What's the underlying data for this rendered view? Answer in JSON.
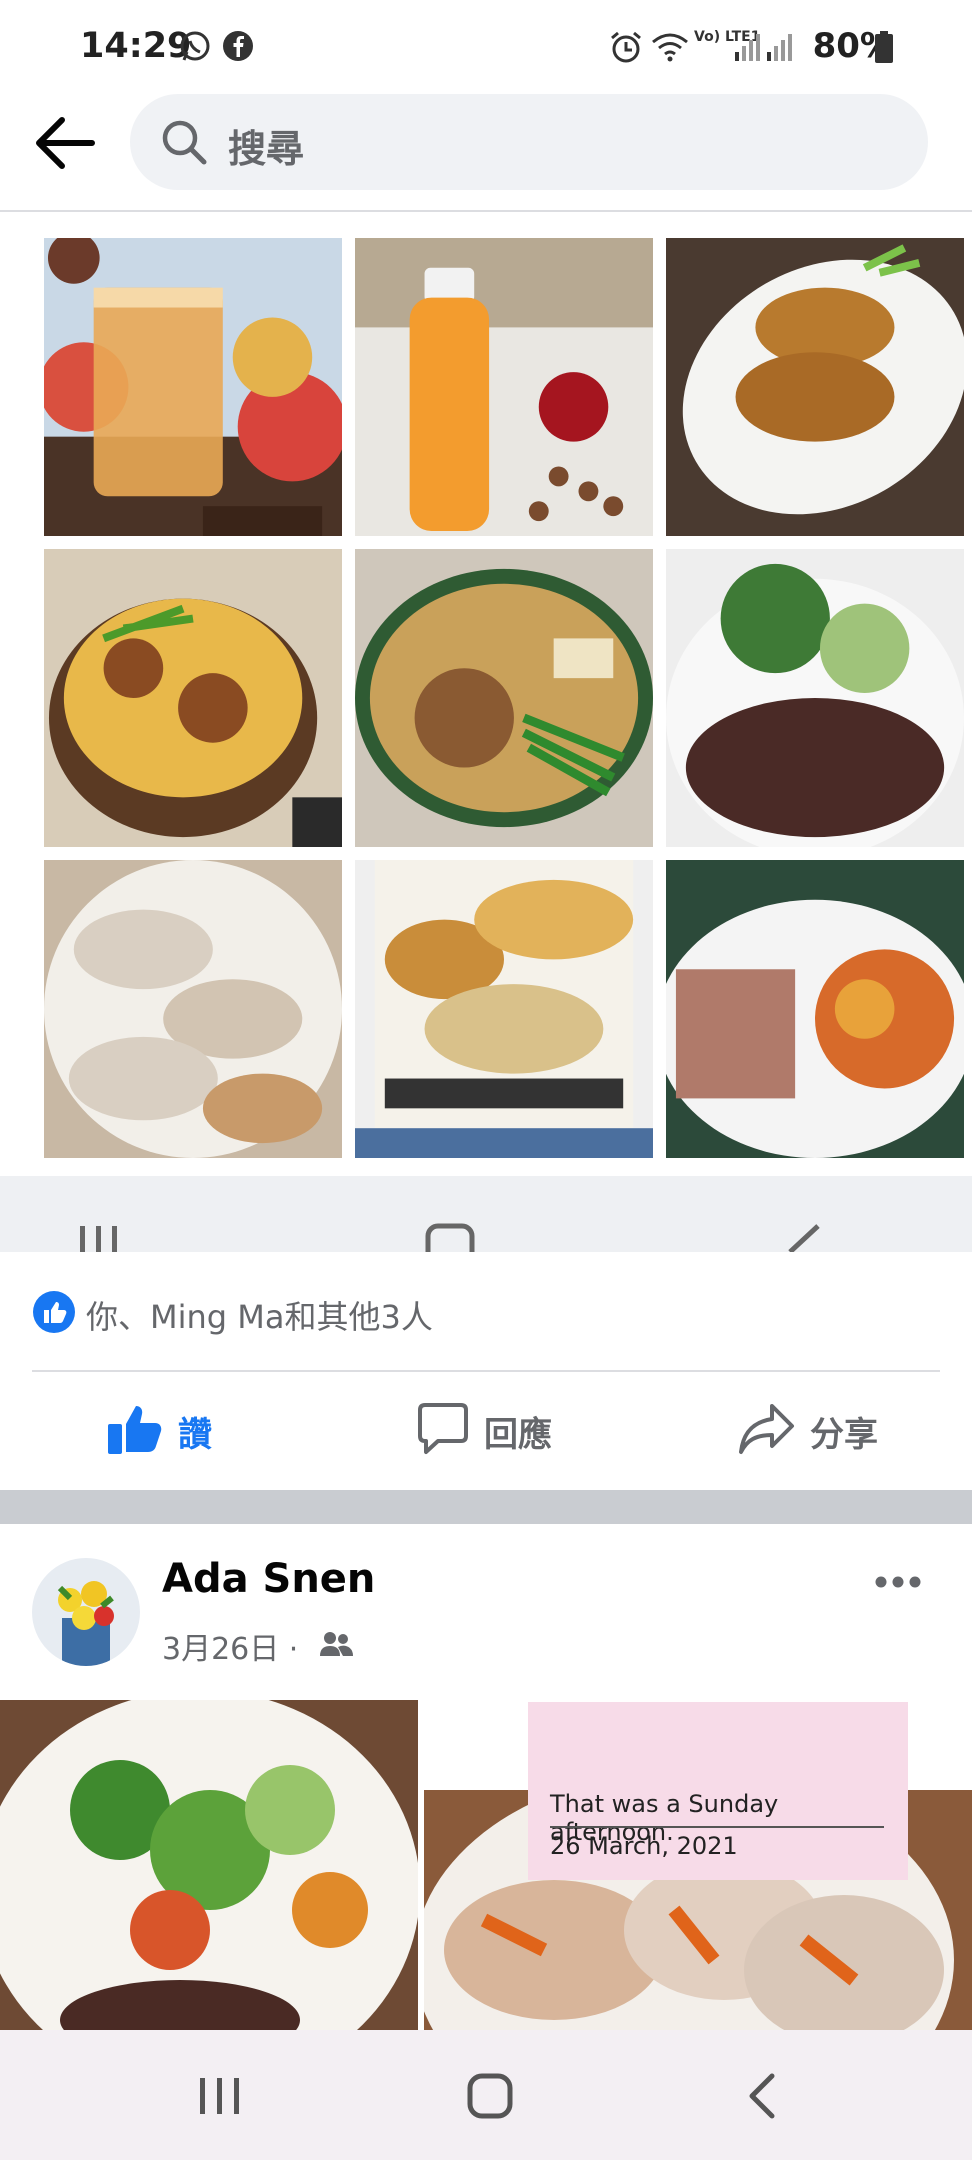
{
  "status_bar": {
    "time": "14:29",
    "battery": "80%",
    "network_label": "Vo) LTE1",
    "left_icons": [
      "whatsapp-icon",
      "facebook-icon"
    ],
    "right_icons": [
      "alarm-icon",
      "wifi-icon",
      "signal-icon",
      "signal-icon",
      "battery-icon"
    ]
  },
  "header": {
    "search_placeholder": "搜尋",
    "back_icon": "back-arrow-icon",
    "search_icon": "search-icon"
  },
  "photo_grid": [
    {
      "name": "apple-tea"
    },
    {
      "name": "juice-bottle"
    },
    {
      "name": "fried-chicken-wings"
    },
    {
      "name": "chicken-rice-bowl"
    },
    {
      "name": "minced-pork-noodle"
    },
    {
      "name": "cucumber-salad"
    },
    {
      "name": "dumplings"
    },
    {
      "name": "meal-printout"
    },
    {
      "name": "pork-and-tofu"
    }
  ],
  "post1": {
    "reactions_text": "你、Ming Ma和其他3人",
    "actions": {
      "like_label": "讚",
      "comment_label": "回應",
      "share_label": "分享"
    }
  },
  "post2": {
    "author": "Ada Snen",
    "date": "3月26日 ·",
    "audience_icon": "friends-icon",
    "more_icon": "more-icon",
    "note_line1": "That was a Sunday afternoon.",
    "note_line2": "26 March, 2021"
  },
  "colors": {
    "accent": "#1877f2",
    "secondary_text": "#65676b",
    "divider": "#dcdde1",
    "search_bg": "#f0f2f5"
  }
}
